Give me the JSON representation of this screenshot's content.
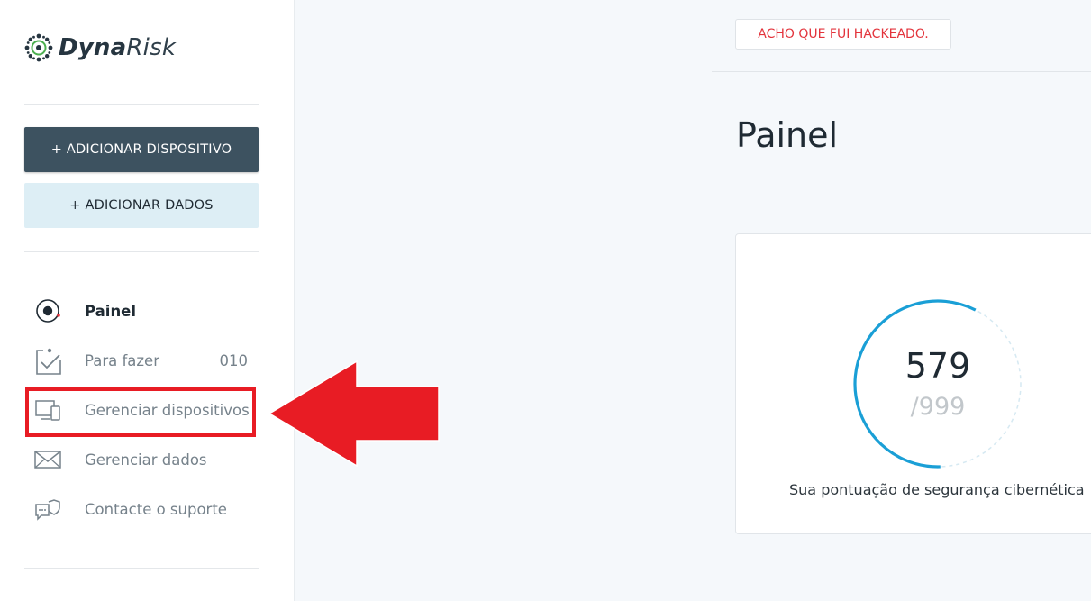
{
  "brand": {
    "name_bold": "Dyna",
    "name_light": "Risk",
    "logo_icon": "gear-dots-icon",
    "logo_accent": "#4caf50"
  },
  "sidebar": {
    "add_device_label": "+ ADICIONAR DISPOSITIVO",
    "add_data_label": "+ ADICIONAR DADOS",
    "nav": [
      {
        "label": "Painel",
        "icon": "dashboard-icon",
        "active": true
      },
      {
        "label": "Para fazer",
        "icon": "todo-checklist-icon",
        "count": "010"
      },
      {
        "label": "Gerenciar dispositivos",
        "icon": "devices-icon"
      },
      {
        "label": "Gerenciar dados",
        "icon": "envelope-icon"
      },
      {
        "label": "Contacte o suporte",
        "icon": "support-chat-icon"
      }
    ]
  },
  "header": {
    "hacked_button": "ACHO QUE FUI HACKEADO."
  },
  "main": {
    "title": "Painel",
    "score_card": {
      "score": "579",
      "max": "/999",
      "score_value": 579,
      "score_max_value": 999,
      "caption": "Sua pontuação de segurança cibernética"
    }
  },
  "annotation": {
    "highlight_color": "#e81c24"
  },
  "colors": {
    "primary_button": "#3d5260",
    "secondary_button": "#ddeef5",
    "gauge": "#1a9fd6",
    "alert_text": "#e3343c"
  }
}
